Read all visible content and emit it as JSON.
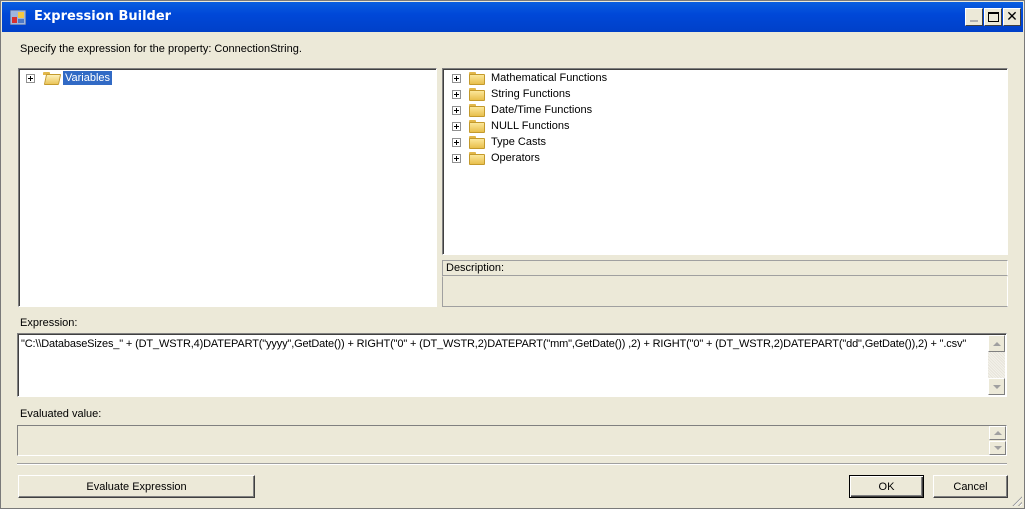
{
  "window": {
    "title": "Expression Builder",
    "icons": {
      "app": "expression-builder-app-icon",
      "minimize": "minimize-icon",
      "maximize": "maximize-icon",
      "close": "close-icon"
    },
    "close_glyph": "✕"
  },
  "prompt": "Specify the expression for the property: ConnectionString.",
  "variables_tree": {
    "items": [
      {
        "label": "Variables",
        "icon": "folder-open-icon",
        "expander": "plus",
        "selected": true
      }
    ]
  },
  "functions_tree": {
    "items": [
      {
        "label": "Mathematical Functions",
        "icon": "folder-icon",
        "expander": "plus"
      },
      {
        "label": "String Functions",
        "icon": "folder-icon",
        "expander": "plus"
      },
      {
        "label": "Date/Time Functions",
        "icon": "folder-icon",
        "expander": "plus"
      },
      {
        "label": "NULL Functions",
        "icon": "folder-icon",
        "expander": "plus"
      },
      {
        "label": "Type Casts",
        "icon": "folder-icon",
        "expander": "plus"
      },
      {
        "label": "Operators",
        "icon": "folder-icon",
        "expander": "plus"
      }
    ]
  },
  "description": {
    "label": "Description:",
    "value": ""
  },
  "expression": {
    "label": "Expression:",
    "value": "\"C:\\\\DatabaseSizes_\" + (DT_WSTR,4)DATEPART(\"yyyy\",GetDate()) + RIGHT(\"0\" + (DT_WSTR,2)DATEPART(\"mm\",GetDate()) ,2) + RIGHT(\"0\" + (DT_WSTR,2)DATEPART(\"dd\",GetDate()),2) + \".csv\""
  },
  "evaluated_value": {
    "label": "Evaluated value:",
    "value": ""
  },
  "buttons": {
    "evaluate": "Evaluate Expression",
    "ok": "OK",
    "cancel": "Cancel"
  },
  "colors": {
    "titlebar": "#0048d8",
    "selection": "#316ac5",
    "dialog_bg": "#ece9d8"
  }
}
